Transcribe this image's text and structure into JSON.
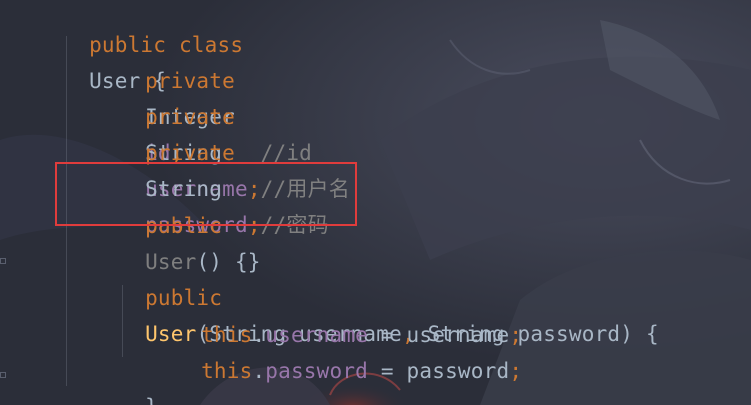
{
  "code": {
    "line1": {
      "kw": "public class",
      "name": "User",
      "brace": " {"
    },
    "line2": {
      "kw": "private",
      "type": "Integer",
      "field": "id",
      "semi": ";",
      "comment": "//id"
    },
    "line3": {
      "kw": "private",
      "type": "String",
      "field": "username",
      "semi": ";",
      "comment": "//用户名"
    },
    "line4": {
      "kw": "private",
      "type": "String",
      "field": "password",
      "semi": ";",
      "comment": "//密码"
    },
    "line5": {
      "kw": "public",
      "name": "User",
      "rest": "() {}"
    },
    "line6": {
      "kw": "public",
      "name": "User",
      "open": "(String username",
      "comma": ",",
      "rest": " String password) {"
    },
    "line7": {
      "kw": "this",
      "dot": ".",
      "field": "username",
      "assign": " = username",
      "semi": ";"
    },
    "line8": {
      "kw": "this",
      "dot": ".",
      "field": "password",
      "assign": " = password",
      "semi": ";"
    },
    "line9": {
      "brace": "}"
    }
  },
  "colors": {
    "keyword": "#cc7832",
    "field": "#9876aa",
    "plain": "#a9b7c6",
    "comment": "#808080",
    "method": "#ffc66d",
    "highlight_border": "#e03c3c"
  }
}
